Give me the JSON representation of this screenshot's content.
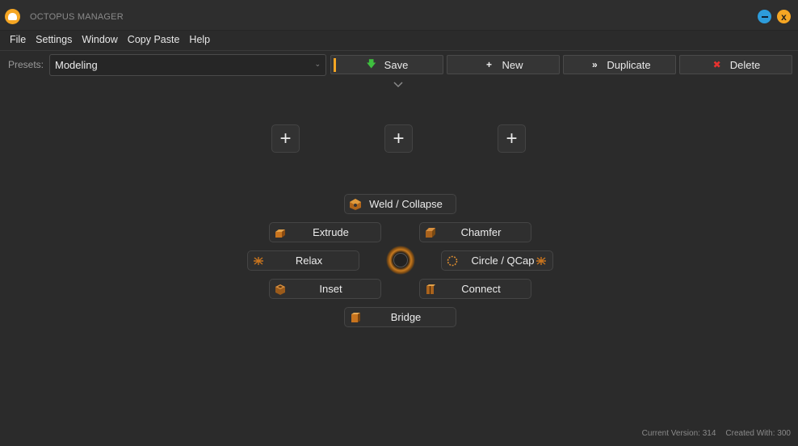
{
  "window": {
    "title": "OCTOPUS MANAGER",
    "close_glyph": "x"
  },
  "menu": [
    "File",
    "Settings",
    "Window",
    "Copy Paste",
    "Help"
  ],
  "presets": {
    "label": "Presets:",
    "selected": "Modeling"
  },
  "toolbar": {
    "save_label": "Save",
    "new_label": "New",
    "duplicate_label": "Duplicate",
    "delete_label": "Delete"
  },
  "add_slots": [
    "+",
    "+",
    "+"
  ],
  "radial": {
    "top": "Weld / Collapse",
    "upper_left": "Extrude",
    "upper_right": "Chamfer",
    "left": "Relax",
    "right": "Circle / QCap",
    "lower_left": "Inset",
    "lower_right": "Connect",
    "bottom": "Bridge"
  },
  "footer": {
    "current_version": "Current Version: 314",
    "created_with": "Created With: 300"
  },
  "colors": {
    "accent": "#f5a623",
    "minimize": "#2d9cdb",
    "save_icon": "#3fbf3f",
    "delete_icon": "#e8322f",
    "background": "#2b2b2b"
  },
  "icons": {
    "save": "arrow-down-icon",
    "new": "plus-icon",
    "duplicate": "double-chevron-right-icon",
    "delete": "x-icon"
  }
}
